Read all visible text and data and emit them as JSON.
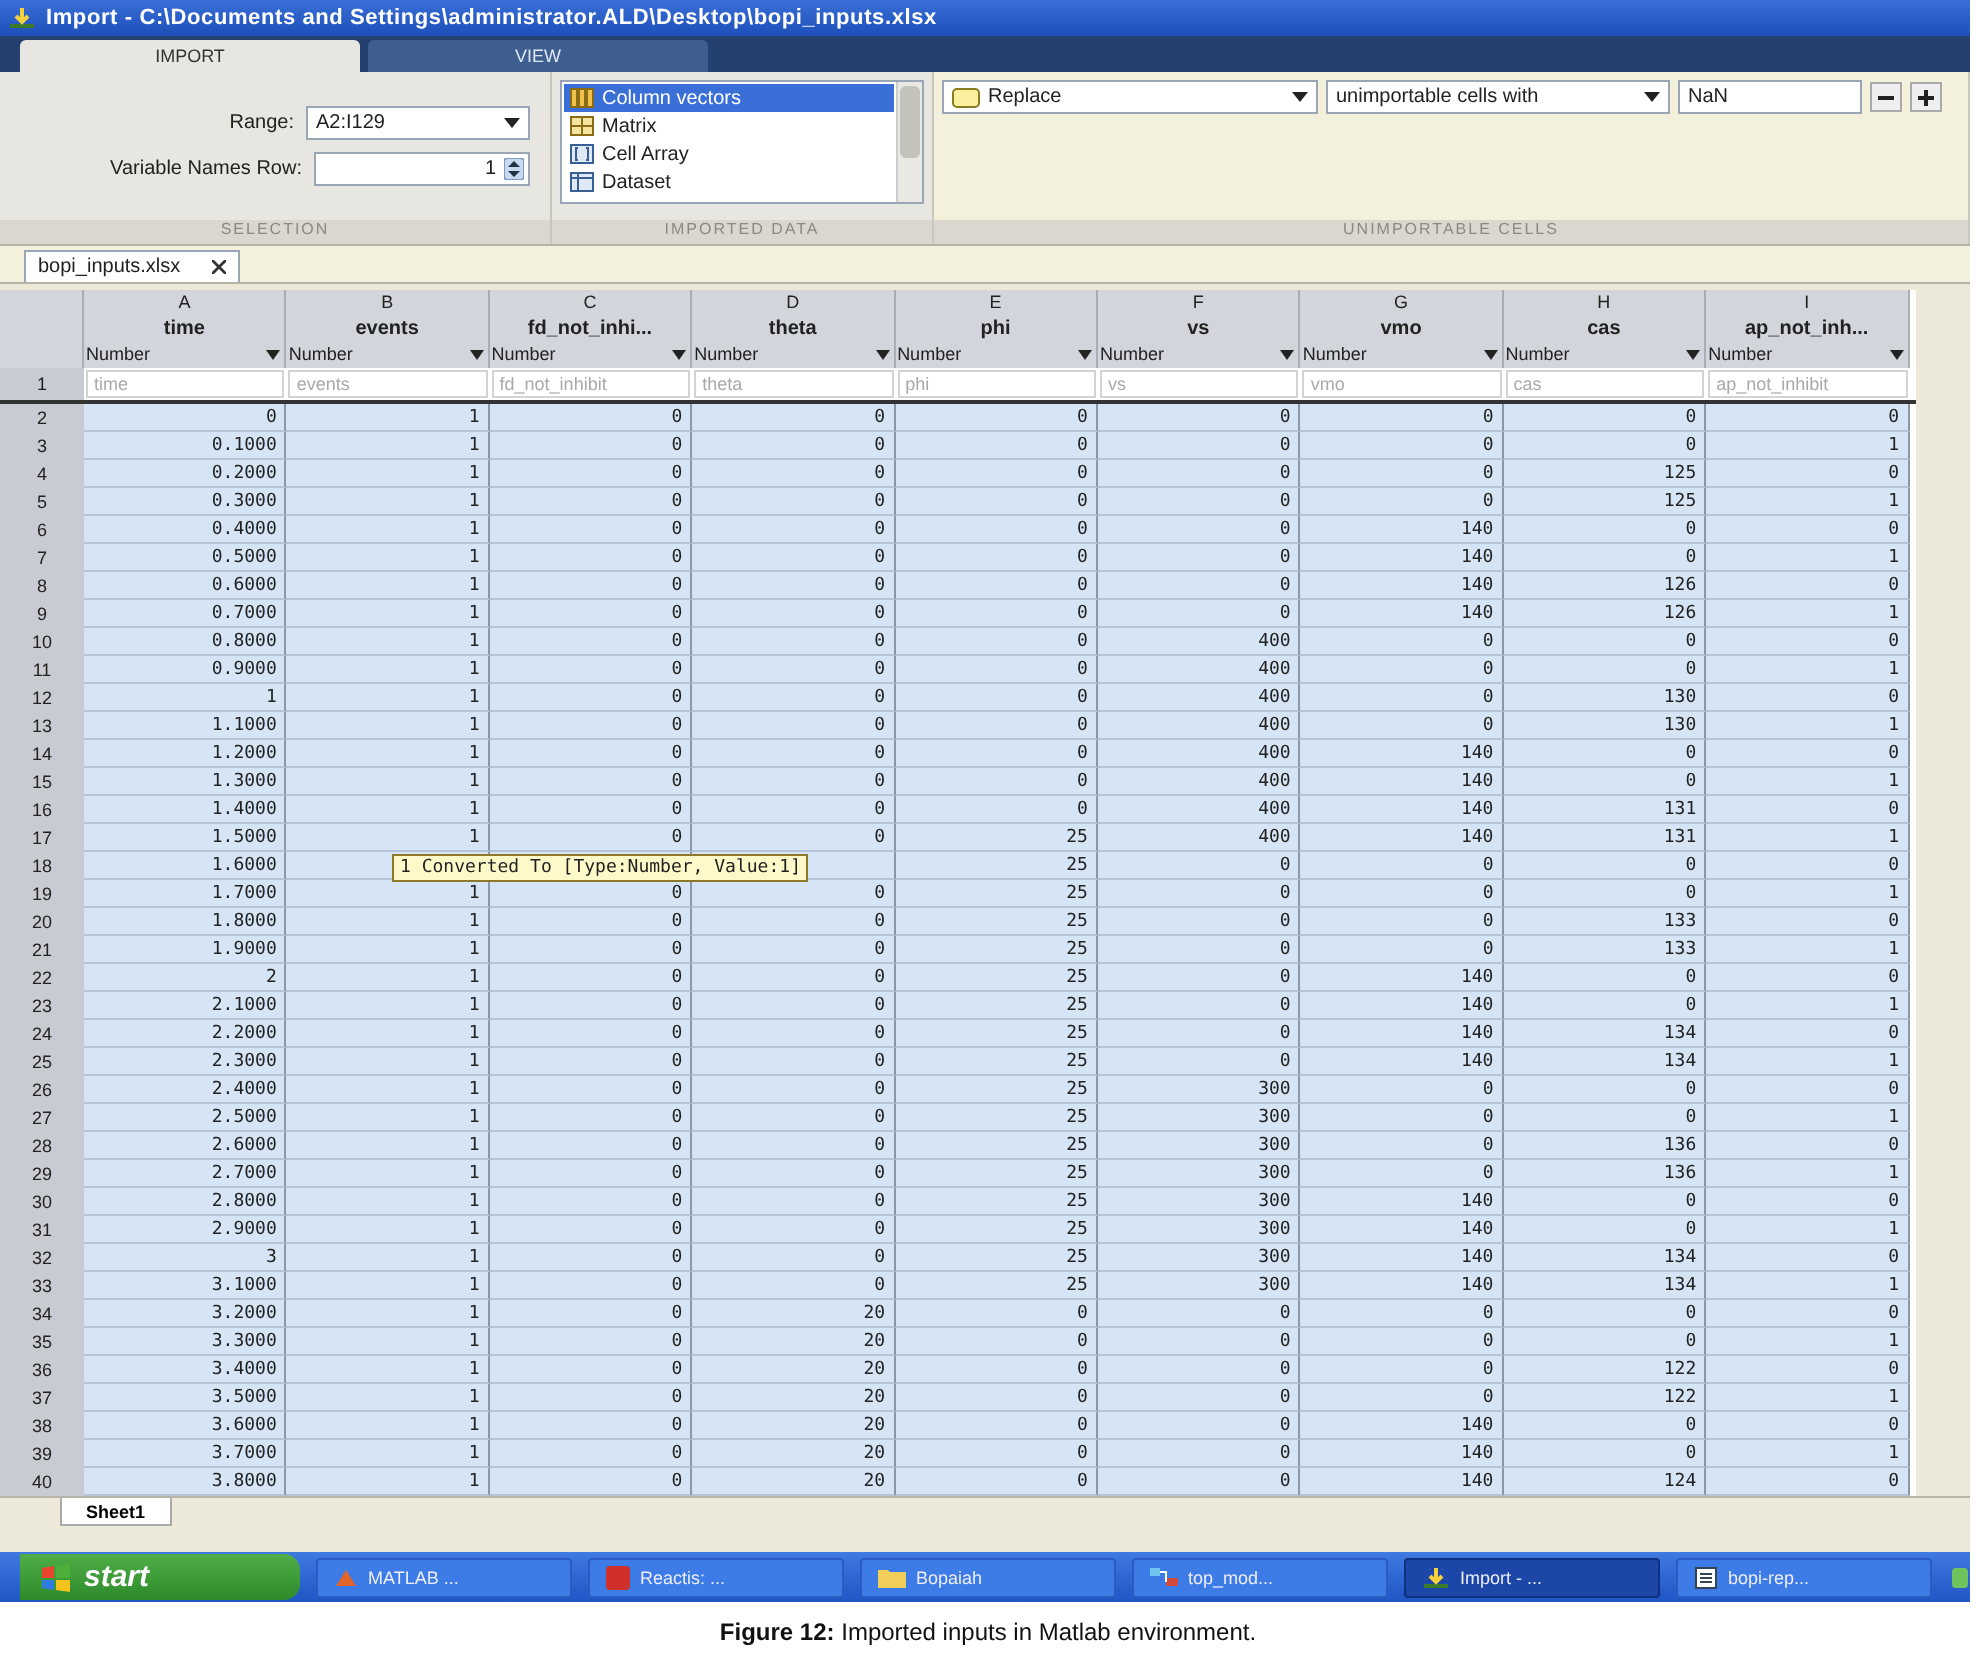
{
  "window": {
    "title": "Import - C:\\Documents and Settings\\administrator.ALD\\Desktop\\bopi_inputs.xlsx"
  },
  "tabs": [
    {
      "label": "IMPORT",
      "selected": true
    },
    {
      "label": "VIEW",
      "selected": false
    }
  ],
  "selection": {
    "range_label": "Range:",
    "range_value": "A2:I129",
    "names_row_label": "Variable Names Row:",
    "names_row_value": "1",
    "section": "SELECTION"
  },
  "imported_data": {
    "items": [
      {
        "label": "Column vectors",
        "kind": "columns",
        "selected": true
      },
      {
        "label": "Matrix",
        "kind": "matrix",
        "selected": false
      },
      {
        "label": "Cell Array",
        "kind": "cell",
        "selected": false
      },
      {
        "label": "Dataset",
        "kind": "dataset",
        "selected": false
      }
    ],
    "section": "IMPORTED DATA"
  },
  "unimportable": {
    "action": "Replace",
    "target": "unimportable cells with",
    "value": "NaN",
    "section": "UNIMPORTABLE CELLS"
  },
  "file_tab": {
    "label": "bopi_inputs.xlsx"
  },
  "table": {
    "cells_selected": true,
    "columns": [
      {
        "letter": "A",
        "name": "time",
        "type": "Number",
        "var": "time"
      },
      {
        "letter": "B",
        "name": "events",
        "type": "Number",
        "var": "events"
      },
      {
        "letter": "C",
        "name": "fd_not_inhi...",
        "type": "Number",
        "var": "fd_not_inhibit"
      },
      {
        "letter": "D",
        "name": "theta",
        "type": "Number",
        "var": "theta"
      },
      {
        "letter": "E",
        "name": "phi",
        "type": "Number",
        "var": "phi"
      },
      {
        "letter": "F",
        "name": "vs",
        "type": "Number",
        "var": "vs"
      },
      {
        "letter": "G",
        "name": "vmo",
        "type": "Number",
        "var": "vmo"
      },
      {
        "letter": "H",
        "name": "cas",
        "type": "Number",
        "var": "cas"
      },
      {
        "letter": "I",
        "name": "ap_not_inh...",
        "type": "Number",
        "var": "ap_not_inhibit"
      }
    ],
    "names_row_number": "1",
    "rows": [
      {
        "number": "2",
        "cells": [
          "0",
          "1",
          "0",
          "0",
          "0",
          "0",
          "0",
          "0",
          "0"
        ]
      },
      {
        "number": "3",
        "cells": [
          "0.1000",
          "1",
          "0",
          "0",
          "0",
          "0",
          "0",
          "0",
          "1"
        ]
      },
      {
        "number": "4",
        "cells": [
          "0.2000",
          "1",
          "0",
          "0",
          "0",
          "0",
          "0",
          "125",
          "0"
        ]
      },
      {
        "number": "5",
        "cells": [
          "0.3000",
          "1",
          "0",
          "0",
          "0",
          "0",
          "0",
          "125",
          "1"
        ]
      },
      {
        "number": "6",
        "cells": [
          "0.4000",
          "1",
          "0",
          "0",
          "0",
          "0",
          "140",
          "0",
          "0"
        ]
      },
      {
        "number": "7",
        "cells": [
          "0.5000",
          "1",
          "0",
          "0",
          "0",
          "0",
          "140",
          "0",
          "1"
        ]
      },
      {
        "number": "8",
        "cells": [
          "0.6000",
          "1",
          "0",
          "0",
          "0",
          "0",
          "140",
          "126",
          "0"
        ]
      },
      {
        "number": "9",
        "cells": [
          "0.7000",
          "1",
          "0",
          "0",
          "0",
          "0",
          "140",
          "126",
          "1"
        ]
      },
      {
        "number": "10",
        "cells": [
          "0.8000",
          "1",
          "0",
          "0",
          "0",
          "400",
          "0",
          "0",
          "0"
        ]
      },
      {
        "number": "11",
        "cells": [
          "0.9000",
          "1",
          "0",
          "0",
          "0",
          "400",
          "0",
          "0",
          "1"
        ]
      },
      {
        "number": "12",
        "cells": [
          "1",
          "1",
          "0",
          "0",
          "0",
          "400",
          "0",
          "130",
          "0"
        ]
      },
      {
        "number": "13",
        "cells": [
          "1.1000",
          "1",
          "0",
          "0",
          "0",
          "400",
          "0",
          "130",
          "1"
        ]
      },
      {
        "number": "14",
        "cells": [
          "1.2000",
          "1",
          "0",
          "0",
          "0",
          "400",
          "140",
          "0",
          "0"
        ]
      },
      {
        "number": "15",
        "cells": [
          "1.3000",
          "1",
          "0",
          "0",
          "0",
          "400",
          "140",
          "0",
          "1"
        ]
      },
      {
        "number": "16",
        "cells": [
          "1.4000",
          "1",
          "0",
          "0",
          "0",
          "400",
          "140",
          "131",
          "0"
        ]
      },
      {
        "number": "17",
        "cells": [
          "1.5000",
          "1",
          "0",
          "0",
          "25",
          "400",
          "140",
          "131",
          "1"
        ]
      },
      {
        "number": "18",
        "cells": [
          "1.6000",
          null,
          null,
          null,
          "25",
          "0",
          "0",
          "0",
          "0"
        ]
      },
      {
        "number": "19",
        "cells": [
          "1.7000",
          "1",
          "0",
          "0",
          "25",
          "0",
          "0",
          "0",
          "1"
        ]
      },
      {
        "number": "20",
        "cells": [
          "1.8000",
          "1",
          "0",
          "0",
          "25",
          "0",
          "0",
          "133",
          "0"
        ]
      },
      {
        "number": "21",
        "cells": [
          "1.9000",
          "1",
          "0",
          "0",
          "25",
          "0",
          "0",
          "133",
          "1"
        ]
      },
      {
        "number": "22",
        "cells": [
          "2",
          "1",
          "0",
          "0",
          "25",
          "0",
          "140",
          "0",
          "0"
        ]
      },
      {
        "number": "23",
        "cells": [
          "2.1000",
          "1",
          "0",
          "0",
          "25",
          "0",
          "140",
          "0",
          "1"
        ]
      },
      {
        "number": "24",
        "cells": [
          "2.2000",
          "1",
          "0",
          "0",
          "25",
          "0",
          "140",
          "134",
          "0"
        ]
      },
      {
        "number": "25",
        "cells": [
          "2.3000",
          "1",
          "0",
          "0",
          "25",
          "0",
          "140",
          "134",
          "1"
        ]
      },
      {
        "number": "26",
        "cells": [
          "2.4000",
          "1",
          "0",
          "0",
          "25",
          "300",
          "0",
          "0",
          "0"
        ]
      },
      {
        "number": "27",
        "cells": [
          "2.5000",
          "1",
          "0",
          "0",
          "25",
          "300",
          "0",
          "0",
          "1"
        ]
      },
      {
        "number": "28",
        "cells": [
          "2.6000",
          "1",
          "0",
          "0",
          "25",
          "300",
          "0",
          "136",
          "0"
        ]
      },
      {
        "number": "29",
        "cells": [
          "2.7000",
          "1",
          "0",
          "0",
          "25",
          "300",
          "0",
          "136",
          "1"
        ]
      },
      {
        "number": "30",
        "cells": [
          "2.8000",
          "1",
          "0",
          "0",
          "25",
          "300",
          "140",
          "0",
          "0"
        ]
      },
      {
        "number": "31",
        "cells": [
          "2.9000",
          "1",
          "0",
          "0",
          "25",
          "300",
          "140",
          "0",
          "1"
        ]
      },
      {
        "number": "32",
        "cells": [
          "3",
          "1",
          "0",
          "0",
          "25",
          "300",
          "140",
          "134",
          "0"
        ]
      },
      {
        "number": "33",
        "cells": [
          "3.1000",
          "1",
          "0",
          "0",
          "25",
          "300",
          "140",
          "134",
          "1"
        ]
      },
      {
        "number": "34",
        "cells": [
          "3.2000",
          "1",
          "0",
          "20",
          "0",
          "0",
          "0",
          "0",
          "0"
        ]
      },
      {
        "number": "35",
        "cells": [
          "3.3000",
          "1",
          "0",
          "20",
          "0",
          "0",
          "0",
          "0",
          "1"
        ]
      },
      {
        "number": "36",
        "cells": [
          "3.4000",
          "1",
          "0",
          "20",
          "0",
          "0",
          "0",
          "122",
          "0"
        ]
      },
      {
        "number": "37",
        "cells": [
          "3.5000",
          "1",
          "0",
          "20",
          "0",
          "0",
          "0",
          "122",
          "1"
        ]
      },
      {
        "number": "38",
        "cells": [
          "3.6000",
          "1",
          "0",
          "20",
          "0",
          "0",
          "140",
          "0",
          "0"
        ]
      },
      {
        "number": "39",
        "cells": [
          "3.7000",
          "1",
          "0",
          "20",
          "0",
          "0",
          "140",
          "0",
          "1"
        ]
      },
      {
        "number": "40",
        "cells": [
          "3.8000",
          "1",
          "0",
          "20",
          "0",
          "0",
          "140",
          "124",
          "0"
        ]
      }
    ],
    "tooltip": "1 Converted To [Type:Number, Value:1]"
  },
  "sheet_tabs": [
    {
      "label": "Sheet1",
      "selected": true
    }
  ],
  "taskbar": {
    "start": "start",
    "items": [
      {
        "label": "MATLAB ...",
        "kind": "matlab",
        "selected": false
      },
      {
        "label": "Reactis: ...",
        "kind": "reactis",
        "selected": false
      },
      {
        "label": "Bopaiah",
        "kind": "folder",
        "selected": false
      },
      {
        "label": "top_mod...",
        "kind": "model",
        "selected": false
      },
      {
        "label": "Import - ...",
        "kind": "import",
        "selected": true
      },
      {
        "label": "bopi-rep...",
        "kind": "doc",
        "selected": false
      }
    ]
  },
  "caption": "**Figure 12:** Imported inputs in Matlab environment."
}
